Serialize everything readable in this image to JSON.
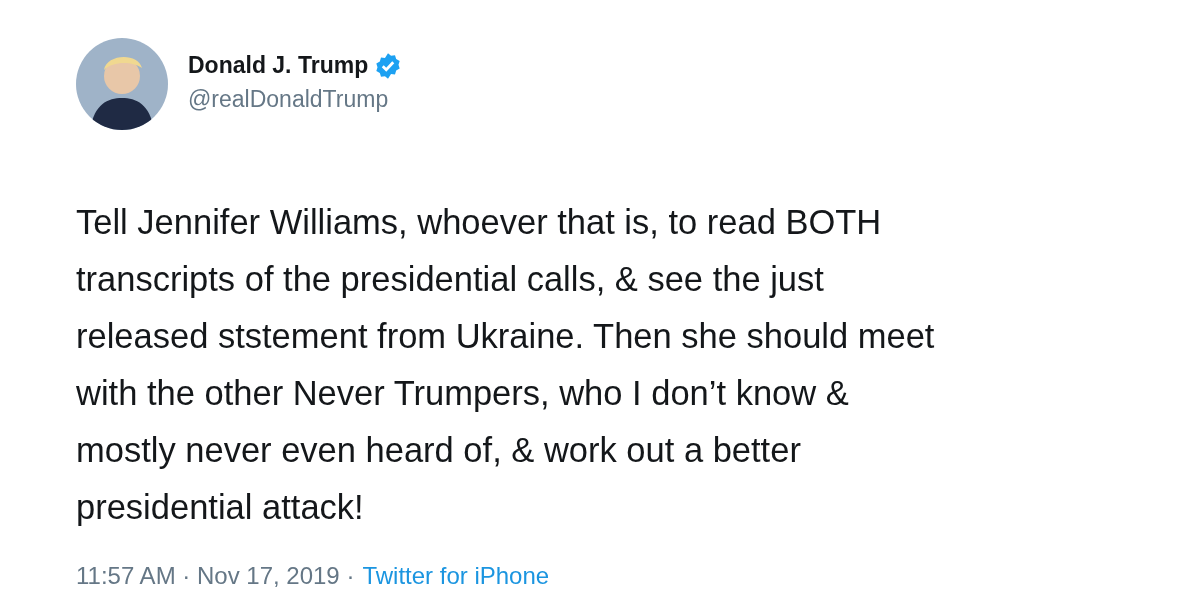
{
  "author": {
    "name": "Donald J. Trump",
    "verified": true,
    "handle": "@realDonaldTrump"
  },
  "tweet": {
    "text": "Tell Jennifer Williams, whoever that is, to read BOTH\ntranscripts of the presidential calls, & see the just\nreleased ststement from Ukraine. Then she should meet\nwith the other Never Trumpers, who I don’t know &\nmostly never even heard of, & work out a better\npresidential attack!"
  },
  "meta": {
    "timestamp": "11:57 AM · Nov 17, 2019 ·",
    "source": "Twitter for iPhone"
  }
}
